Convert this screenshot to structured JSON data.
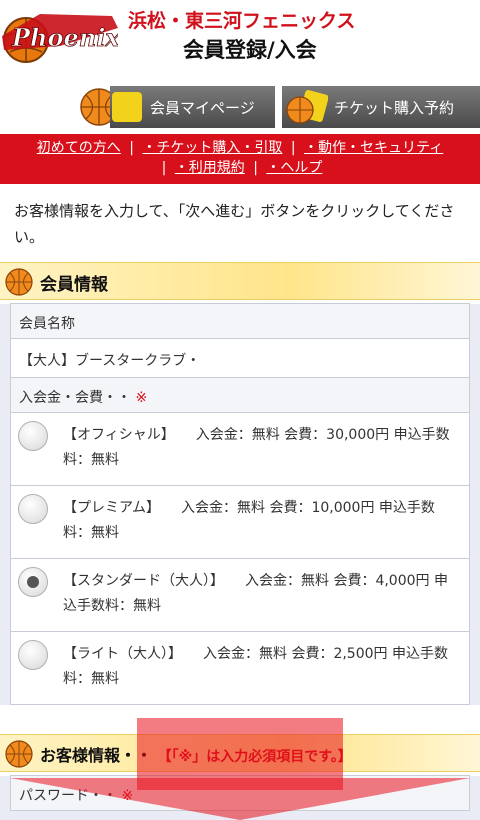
{
  "header": {
    "logo_text": "Phoenix",
    "team_name": "浜松・東三河フェニックス",
    "page_title": "会員登録/入会"
  },
  "nav": {
    "mypage_label": "会員マイページ",
    "ticket_label": "チケット購入予約"
  },
  "red_nav": {
    "items": [
      "初めての方へ",
      "・チケット購入・引取",
      "・動作・セキュリティ",
      "・利用規約",
      "・ヘルプ"
    ]
  },
  "intro_text": "お客様情報を入力して、「次へ進む」ボタンをクリックしてください。",
  "member_section": {
    "title": "会員情報",
    "name_label": "会員名称",
    "name_value": "【大人】ブースタークラブ・",
    "fee_label": "入会金・会費・・",
    "required_mark": "※",
    "options": [
      {
        "text": "【オフィシャル】　　入会金：無料 会費：30,000円 申込手数料：無料",
        "selected": false
      },
      {
        "text": "【プレミアム】　　入会金：無料 会費：10,000円 申込手数料：無料",
        "selected": false
      },
      {
        "text": "【スタンダード（大人）】　　入会金：無料 会費：4,000円 申込手数料：無料",
        "selected": true
      },
      {
        "text": "【ライト（大人）】　　入会金：無料 会費：2,500円 申込手数料：無料",
        "selected": false
      }
    ]
  },
  "customer_section": {
    "title": "お客様情報・・",
    "note": "【「※」は入力必須項目です。】",
    "password_label": "パスワード・・",
    "required_mark": "※"
  },
  "colors": {
    "brand_red": "#d8101c",
    "nav_gray": "#5a5a5a",
    "section_yellow": "#ffe58a"
  }
}
